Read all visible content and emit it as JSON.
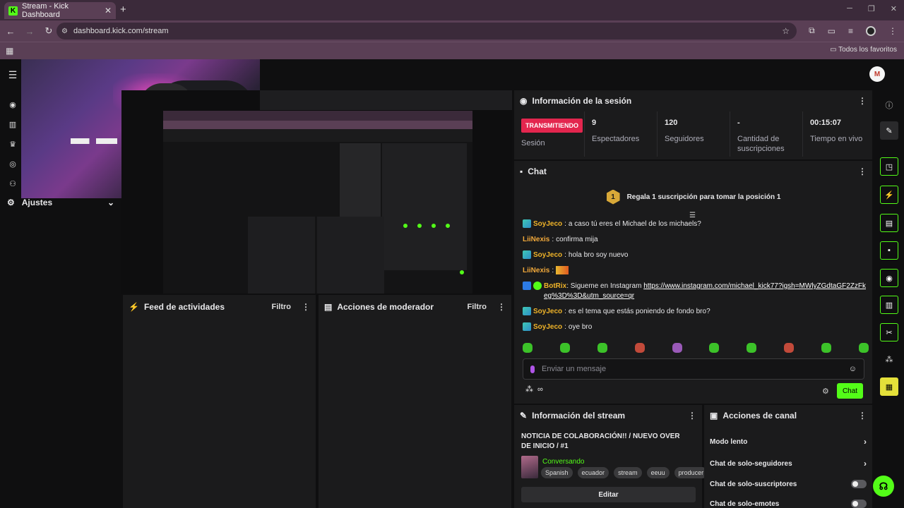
{
  "browser": {
    "tab_title": "Stream - Kick Dashboard",
    "favicon_letter": "K",
    "new_tab": "+",
    "url": "dashboard.kick.com/stream",
    "bookmarks_label": "Todos los favoritos"
  },
  "topbar": {
    "avatar_letter": "M"
  },
  "sidebar": {
    "settings_label": "Ajustes"
  },
  "session": {
    "title": "Información de la sesión",
    "live_badge": "TRANSMITIENDO",
    "live_label": "Sesión",
    "stats": [
      {
        "value": "9",
        "label": "Espectadores"
      },
      {
        "value": "120",
        "label": "Seguidores"
      },
      {
        "value": "-",
        "label": "Cantidad de suscripciones"
      },
      {
        "value": "00:15:07",
        "label": "Tiempo en vivo"
      }
    ]
  },
  "chat": {
    "title": "Chat",
    "gift_num": "1",
    "gift_text": "Regala 1 suscripción para tomar la posición 1",
    "messages": [
      {
        "user": "SoyJeco",
        "text": "a caso tú eres el Michael de los michaels?"
      },
      {
        "user": "LiiNexis",
        "text": "confirma mija"
      },
      {
        "user": "SoyJeco",
        "text": "hola bro soy nuevo"
      },
      {
        "user": "LiiNexis",
        "text": ""
      },
      {
        "user": "BotRix",
        "text": "Sigueme en Instagram ",
        "link": "https://www.instagram.com/michael_kick77?igsh=MWlyZGdtaGF2ZzFkeg%3D%3D&utm_source=qr"
      },
      {
        "user": "SoyJeco",
        "text": "es el tema que estás poniendo de fondo bro?"
      },
      {
        "user": "SoyJeco",
        "text": "oye bro"
      }
    ],
    "input_placeholder": "Enviar un mensaje",
    "send_label": "Chat",
    "bot_label": "∞"
  },
  "feed": {
    "title": "Feed de actividades",
    "filter": "Filtro"
  },
  "modactions": {
    "title": "Acciones de moderador",
    "filter": "Filtro"
  },
  "stream_info": {
    "title": "Información del stream",
    "stream_title": "NOTICIA DE COLABORACIÓN!! / NUEVO OVER DE INICIO / #1",
    "category": "Conversando",
    "tags": [
      "Spanish",
      "ecuador",
      "stream",
      "eeuu",
      "producer"
    ],
    "edit_label": "Editar"
  },
  "channel_actions": {
    "title": "Acciones de canal",
    "items": [
      "Modo lento",
      "Chat de solo-seguidores",
      "Chat de solo-suscriptores",
      "Chat de solo-emotes"
    ]
  },
  "colors": {
    "accent": "#53fc18",
    "live": "#e3264e",
    "panel": "#1b1b1c"
  }
}
